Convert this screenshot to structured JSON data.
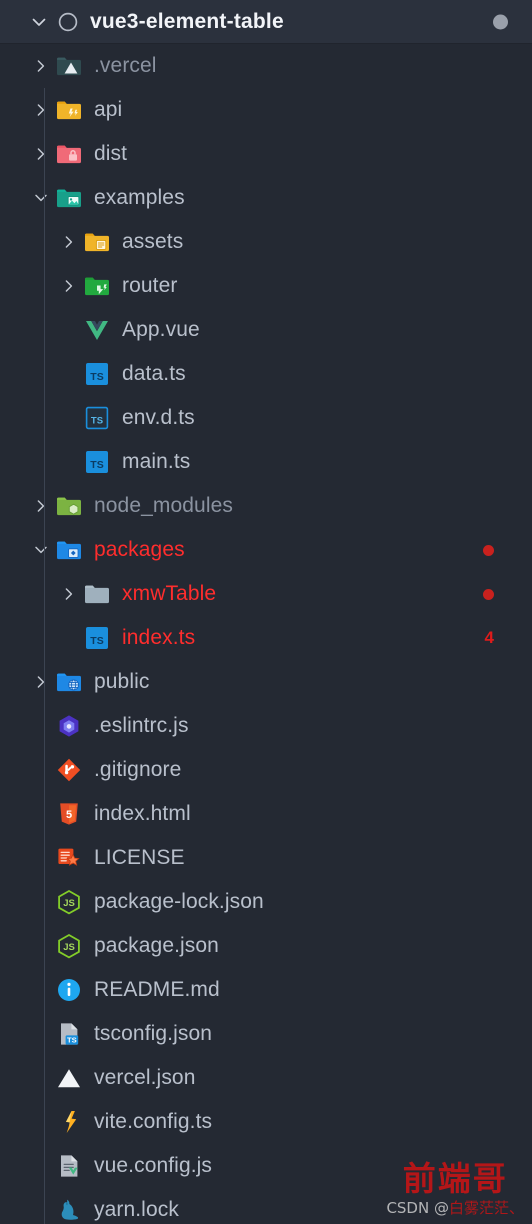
{
  "header": {
    "title": "vue3-element-table",
    "chevron_icon": "chevron-down-icon",
    "repo_icon": "circle-outline-icon",
    "status_dot_icon": "modified-dot-icon"
  },
  "tree": {
    "items": [
      {
        "label": ".vercel",
        "depth": 1,
        "kind": "folder",
        "twisty": "collapsed",
        "icon": "folder-vercel-icon",
        "state": "dim",
        "badge": ""
      },
      {
        "label": "api",
        "depth": 1,
        "kind": "folder",
        "twisty": "collapsed",
        "icon": "folder-api-icon",
        "state": "normal",
        "badge": ""
      },
      {
        "label": "dist",
        "depth": 1,
        "kind": "folder",
        "twisty": "collapsed",
        "icon": "folder-dist-icon",
        "state": "normal",
        "badge": ""
      },
      {
        "label": "examples",
        "depth": 1,
        "kind": "folder",
        "twisty": "expanded",
        "icon": "folder-examples-icon",
        "state": "normal",
        "badge": ""
      },
      {
        "label": "assets",
        "depth": 2,
        "kind": "folder",
        "twisty": "collapsed",
        "icon": "folder-assets-icon",
        "state": "normal",
        "badge": ""
      },
      {
        "label": "router",
        "depth": 2,
        "kind": "folder",
        "twisty": "collapsed",
        "icon": "folder-router-icon",
        "state": "normal",
        "badge": ""
      },
      {
        "label": "App.vue",
        "depth": 2,
        "kind": "file",
        "twisty": "none",
        "icon": "vue-file-icon",
        "state": "normal",
        "badge": ""
      },
      {
        "label": "data.ts",
        "depth": 2,
        "kind": "file",
        "twisty": "none",
        "icon": "typescript-file-icon",
        "state": "normal",
        "badge": ""
      },
      {
        "label": "env.d.ts",
        "depth": 2,
        "kind": "file",
        "twisty": "none",
        "icon": "typescript-def-file-icon",
        "state": "normal",
        "badge": ""
      },
      {
        "label": "main.ts",
        "depth": 2,
        "kind": "file",
        "twisty": "none",
        "icon": "typescript-file-icon",
        "state": "normal",
        "badge": ""
      },
      {
        "label": "node_modules",
        "depth": 1,
        "kind": "folder",
        "twisty": "collapsed",
        "icon": "folder-node-icon",
        "state": "dim",
        "badge": ""
      },
      {
        "label": "packages",
        "depth": 1,
        "kind": "folder",
        "twisty": "expanded",
        "icon": "folder-packages-icon",
        "state": "modified",
        "badge": "dot"
      },
      {
        "label": "xmwTable",
        "depth": 2,
        "kind": "folder",
        "twisty": "collapsed",
        "icon": "folder-plain-icon",
        "state": "modified",
        "badge": "dot"
      },
      {
        "label": "index.ts",
        "depth": 2,
        "kind": "file",
        "twisty": "none",
        "icon": "typescript-file-icon",
        "state": "modified",
        "badge": "4"
      },
      {
        "label": "public",
        "depth": 1,
        "kind": "folder",
        "twisty": "collapsed",
        "icon": "folder-public-icon",
        "state": "normal",
        "badge": ""
      },
      {
        "label": ".eslintrc.js",
        "depth": 1,
        "kind": "file",
        "twisty": "none",
        "icon": "eslint-file-icon",
        "state": "normal",
        "badge": ""
      },
      {
        "label": ".gitignore",
        "depth": 1,
        "kind": "file",
        "twisty": "none",
        "icon": "git-file-icon",
        "state": "normal",
        "badge": ""
      },
      {
        "label": "index.html",
        "depth": 1,
        "kind": "file",
        "twisty": "none",
        "icon": "html-file-icon",
        "state": "normal",
        "badge": ""
      },
      {
        "label": "LICENSE",
        "depth": 1,
        "kind": "file",
        "twisty": "none",
        "icon": "license-file-icon",
        "state": "normal",
        "badge": ""
      },
      {
        "label": "package-lock.json",
        "depth": 1,
        "kind": "file",
        "twisty": "none",
        "icon": "nodejs-file-icon",
        "state": "normal",
        "badge": ""
      },
      {
        "label": "package.json",
        "depth": 1,
        "kind": "file",
        "twisty": "none",
        "icon": "nodejs-file-icon",
        "state": "normal",
        "badge": ""
      },
      {
        "label": "README.md",
        "depth": 1,
        "kind": "file",
        "twisty": "none",
        "icon": "readme-info-file-icon",
        "state": "normal",
        "badge": ""
      },
      {
        "label": "tsconfig.json",
        "depth": 1,
        "kind": "file",
        "twisty": "none",
        "icon": "tsconfig-file-icon",
        "state": "normal",
        "badge": ""
      },
      {
        "label": "vercel.json",
        "depth": 1,
        "kind": "file",
        "twisty": "none",
        "icon": "vercel-file-icon",
        "state": "normal",
        "badge": ""
      },
      {
        "label": "vite.config.ts",
        "depth": 1,
        "kind": "file",
        "twisty": "none",
        "icon": "vite-file-icon",
        "state": "normal",
        "badge": ""
      },
      {
        "label": "vue.config.js",
        "depth": 1,
        "kind": "file",
        "twisty": "none",
        "icon": "vue-config-file-icon",
        "state": "normal",
        "badge": ""
      },
      {
        "label": "yarn.lock",
        "depth": 1,
        "kind": "file",
        "twisty": "none",
        "icon": "yarn-file-icon",
        "state": "normal",
        "badge": ""
      }
    ]
  },
  "watermark": {
    "big": "前端哥",
    "small_prefix": "CSDN @",
    "small_name": "白雾茫茫、"
  },
  "colors": {
    "background": "#242933",
    "header_background": "#2b313d",
    "text": "#b9c0cc",
    "text_dim": "#8b93a1",
    "modified": "#ff2d2d",
    "badge": "#c9211e"
  }
}
